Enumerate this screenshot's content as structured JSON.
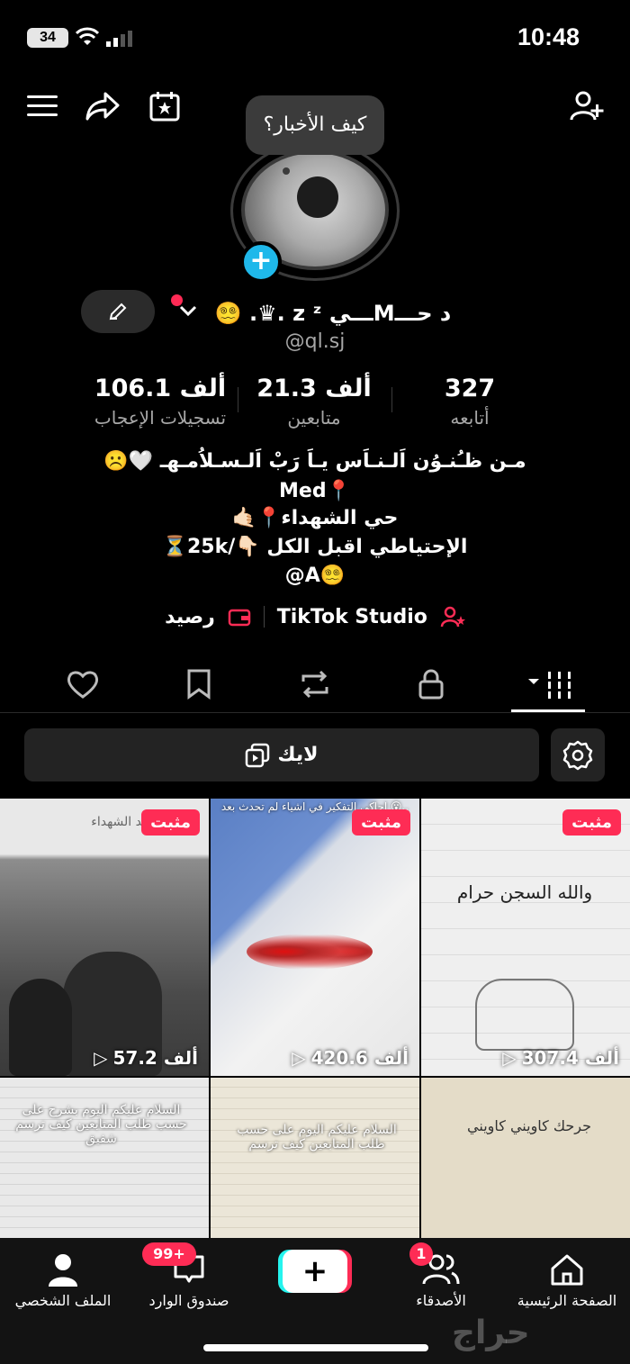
{
  "status": {
    "time": "10:48",
    "battery": "34"
  },
  "profile": {
    "bubble": "كيف الأخبار؟",
    "name": "د حـــMـــي z ᶻ .♛. 😵‍💫",
    "handle": "@ql.sj",
    "stats": [
      {
        "value": "327",
        "label": "أتابعه"
      },
      {
        "value": "21.3 ألف",
        "label": "متابعين"
      },
      {
        "value": "106.1 ألف",
        "label": "تسجيلات الإعجاب"
      }
    ],
    "bio": [
      "مـن ظـُنـوُن اَلـنـاَس يـاَ رَبْ  اَلـسـلاُمـهـ 🤍☹️",
      "Med📍",
      "حي الشهداء📍🤙🏻",
      "الإحتياطي اقبل الكل 👇🏻/25k⏳",
      "@A😵‍💫"
    ],
    "studio_label": "TikTok Studio",
    "balance_label": "رصيد"
  },
  "like_button": "لايك",
  "videos": [
    {
      "pin": "مثبت",
      "views": "57.2 ألف",
      "caption": "حي سيد الشهداء"
    },
    {
      "pin": "مثبت",
      "views": "420.6 ألف",
      "caption": "احاكي التفكير في اشياء لم تحدث بعد 😮.."
    },
    {
      "pin": "مثبت",
      "views": "307.4 ألف",
      "caption": "والله السجن حرام"
    },
    {
      "pin": "",
      "views": "",
      "caption": "السلام عليكم اليوم بشرح على حسب طلب المتابعين كيف ترسم شفيق"
    },
    {
      "pin": "",
      "views": "",
      "caption": "السلام عليكم اليوم على حسب طلب المتابعين كيف ترسم"
    },
    {
      "pin": "",
      "views": "",
      "caption": "جرحك كاويني كاويني"
    }
  ],
  "nav": {
    "profile": "الملف الشخصي",
    "inbox": "صندوق الوارد",
    "inbox_badge": "99+",
    "friends": "الأصدقاء",
    "friends_badge": "1",
    "home": "الصفحة الرئيسية"
  },
  "watermark": "حراج"
}
